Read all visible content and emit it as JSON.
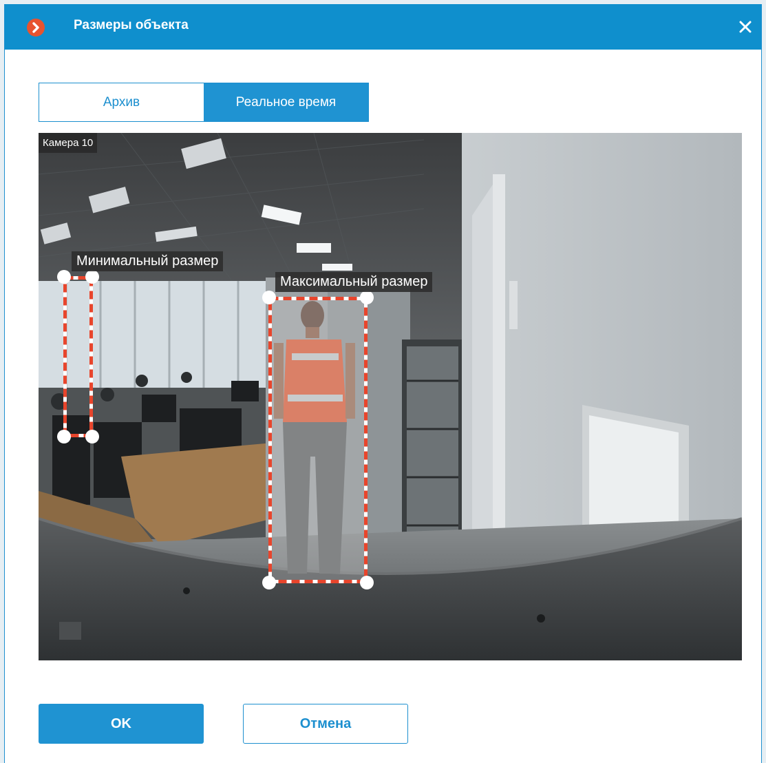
{
  "dialog": {
    "title": "Размеры объекта",
    "logo_icon": "chevron-right-icon",
    "close_icon": "close-icon",
    "accent_color": "#1f93d2",
    "logo_color": "#e7532f"
  },
  "tabs": [
    {
      "label": "Архив",
      "active": false
    },
    {
      "label": "Реальное время",
      "active": true
    }
  ],
  "camera": {
    "label": "Камера 10"
  },
  "zones": {
    "min": {
      "label": "Минимальный размер"
    },
    "max": {
      "label": "Максимальный размер"
    },
    "outline_color": "#e8452c"
  },
  "buttons": {
    "ok": "OK",
    "cancel": "Отмена"
  }
}
